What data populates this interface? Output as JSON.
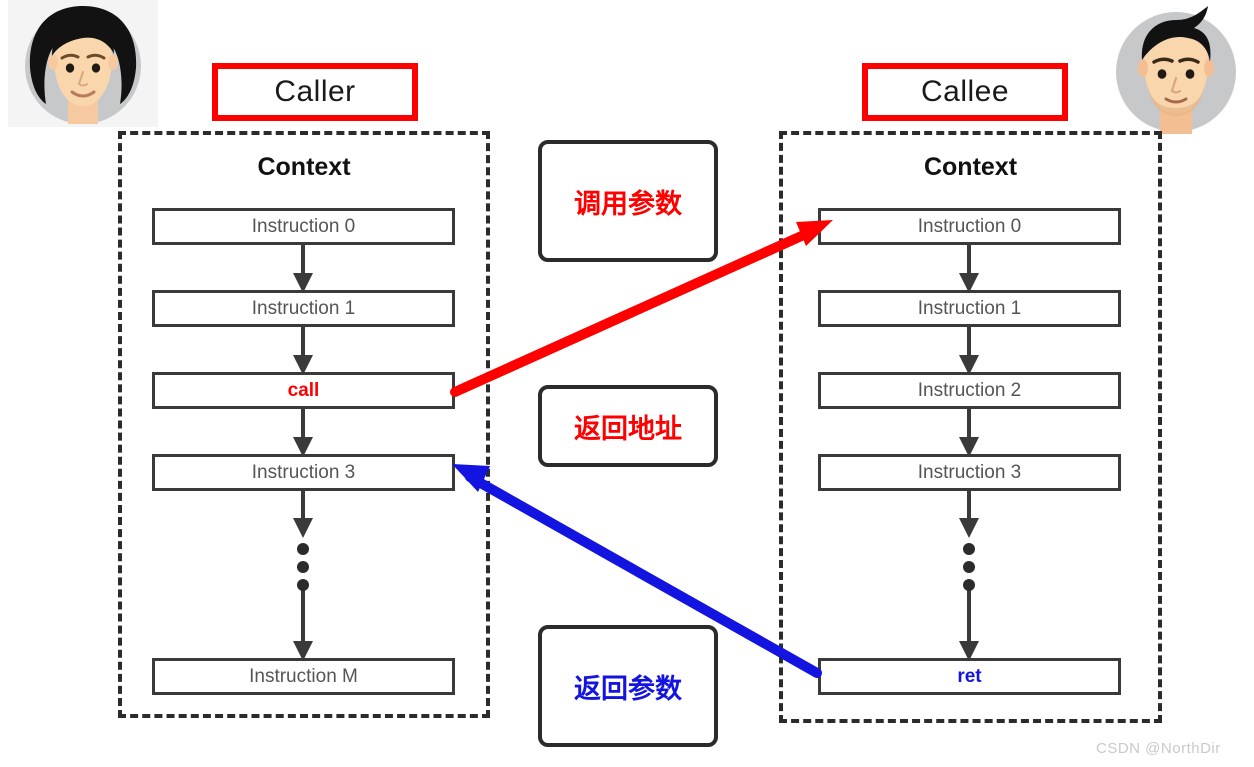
{
  "watermark": {
    "text": "CSDN @NorthDir"
  },
  "colors": {
    "red": "#ff0000",
    "blue": "#1414e0",
    "box_border": "#3a3a3a",
    "dashed_border": "#2b2b2b",
    "instruction_text": "#555555",
    "watermark": "#c9c9c9"
  },
  "caller": {
    "role_label": "Caller",
    "context_label": "Context",
    "avatar_name": "caller-avatar-woman",
    "instructions": [
      {
        "label": "Instruction 0",
        "style": "plain"
      },
      {
        "label": "Instruction 1",
        "style": "plain"
      },
      {
        "label": "call",
        "style": "keyword-red"
      },
      {
        "label": "Instruction 3",
        "style": "plain"
      },
      {
        "label": "Instruction M",
        "style": "plain"
      }
    ]
  },
  "callee": {
    "role_label": "Callee",
    "context_label": "Context",
    "avatar_name": "callee-avatar-man",
    "instructions": [
      {
        "label": "Instruction 0",
        "style": "plain"
      },
      {
        "label": "Instruction 1",
        "style": "plain"
      },
      {
        "label": "Instruction 2",
        "style": "plain"
      },
      {
        "label": "Instruction 3",
        "style": "plain"
      },
      {
        "label": "ret",
        "style": "keyword-blue"
      }
    ]
  },
  "notes": [
    {
      "label": "调用参数",
      "color": "red",
      "name": "note-call-arguments"
    },
    {
      "label": "返回地址",
      "color": "red",
      "name": "note-return-address"
    },
    {
      "label": "返回参数",
      "color": "blue",
      "name": "note-return-values"
    }
  ],
  "arrows": {
    "call_arrow": {
      "color": "#ff0000",
      "from": "caller-call",
      "to": "callee-instruction-0"
    },
    "return_arrow": {
      "color": "#1414e0",
      "from": "callee-ret",
      "to": "caller-instruction-3"
    }
  }
}
